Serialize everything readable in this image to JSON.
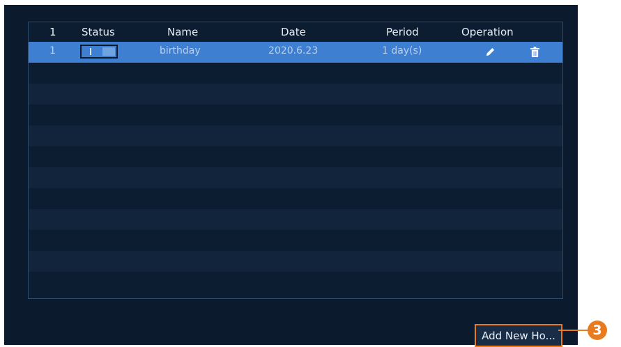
{
  "table": {
    "headers": {
      "index": "1",
      "status": "Status",
      "name": "Name",
      "date": "Date",
      "period": "Period",
      "operation": "Operation"
    },
    "rows": [
      {
        "index": "1",
        "status": "on",
        "name": "birthday",
        "date": "2020.6.23",
        "period": "1 day(s)",
        "edit_icon": "pencil-icon",
        "delete_icon": "trash-icon"
      }
    ]
  },
  "add_button": {
    "label": "Add New Ho..."
  },
  "callout": {
    "number": "3"
  },
  "colors": {
    "panel_bg": "#0b1a2c",
    "selected_row": "#3f7fd1",
    "highlight": "#e87b1e"
  }
}
